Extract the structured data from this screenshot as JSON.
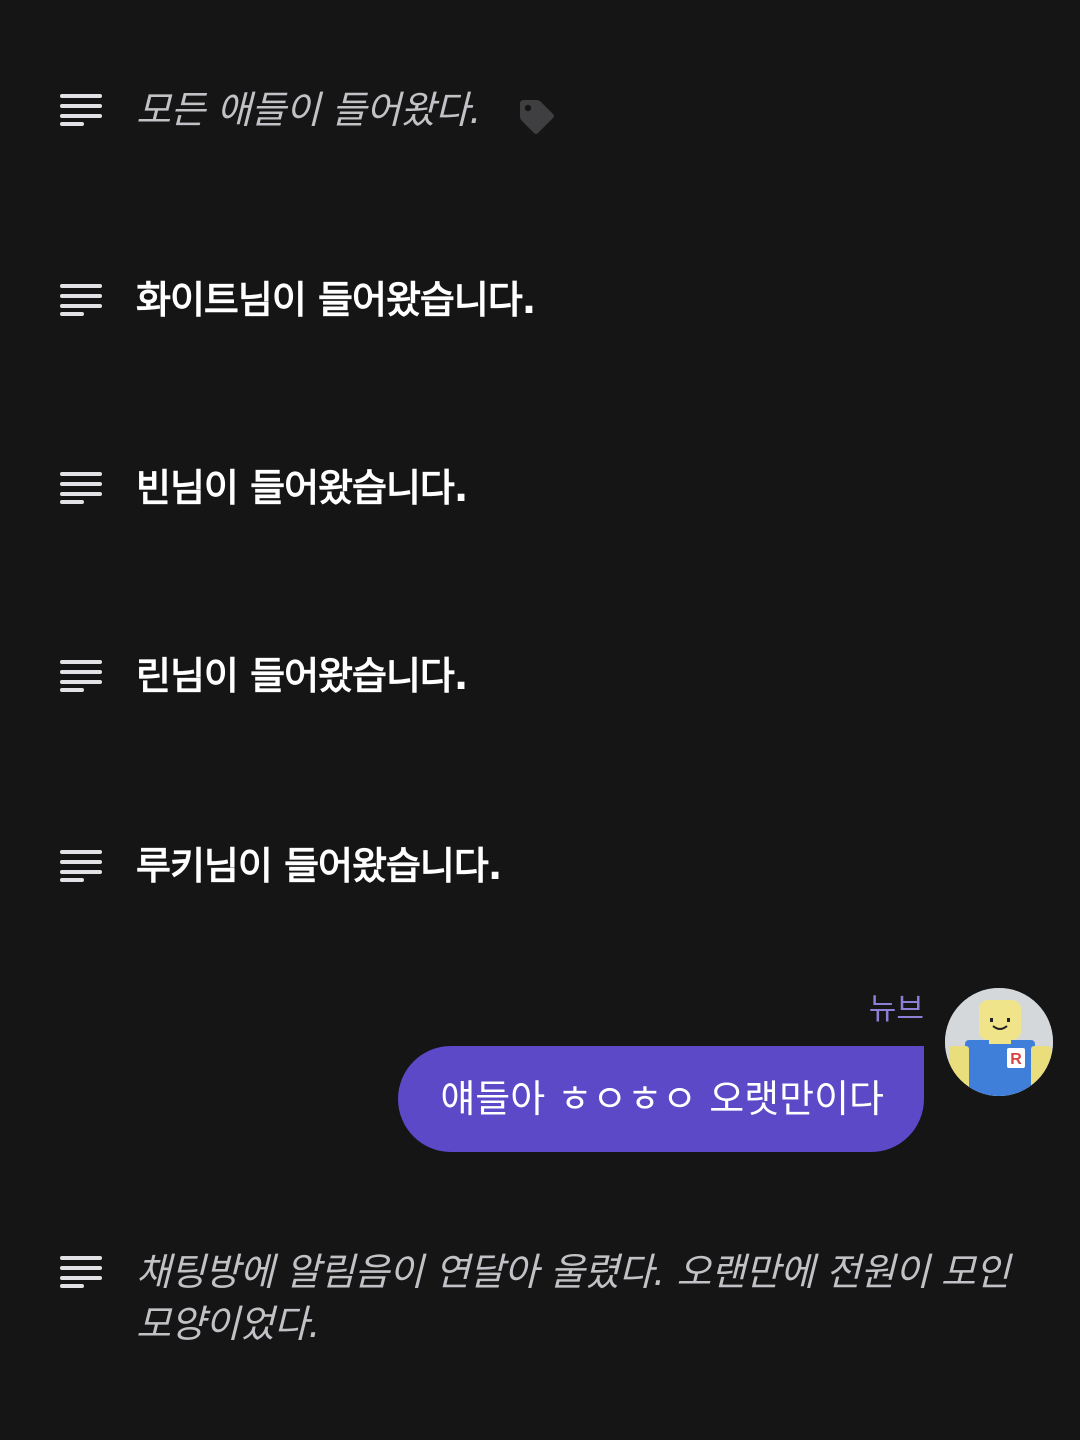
{
  "feed": {
    "narration_1": "모든 애들이 들어왔다.",
    "notices": [
      "화이트님이 들어왔습니다.",
      "빈님이 들어왔습니다.",
      "린님이 들어왔습니다.",
      "루키님이 들어왔습니다."
    ],
    "message": {
      "sender": "뉴브",
      "text": "얘들아 ㅎㅇㅎㅇ 오랫만이다"
    },
    "narration_2_line1": "채팅방에 알림음이 연달아 울렸다. 오랜만에 전원이 모인",
    "narration_2_line2": "모양이었다."
  },
  "icons": {
    "row_icon": "text-lines-icon",
    "tag": "tag-icon",
    "avatar": "avatar"
  },
  "colors": {
    "background": "#151516",
    "bubble": "#5b49c8",
    "sender_name": "#8b80d6",
    "narration_text": "#c2c2c6"
  }
}
